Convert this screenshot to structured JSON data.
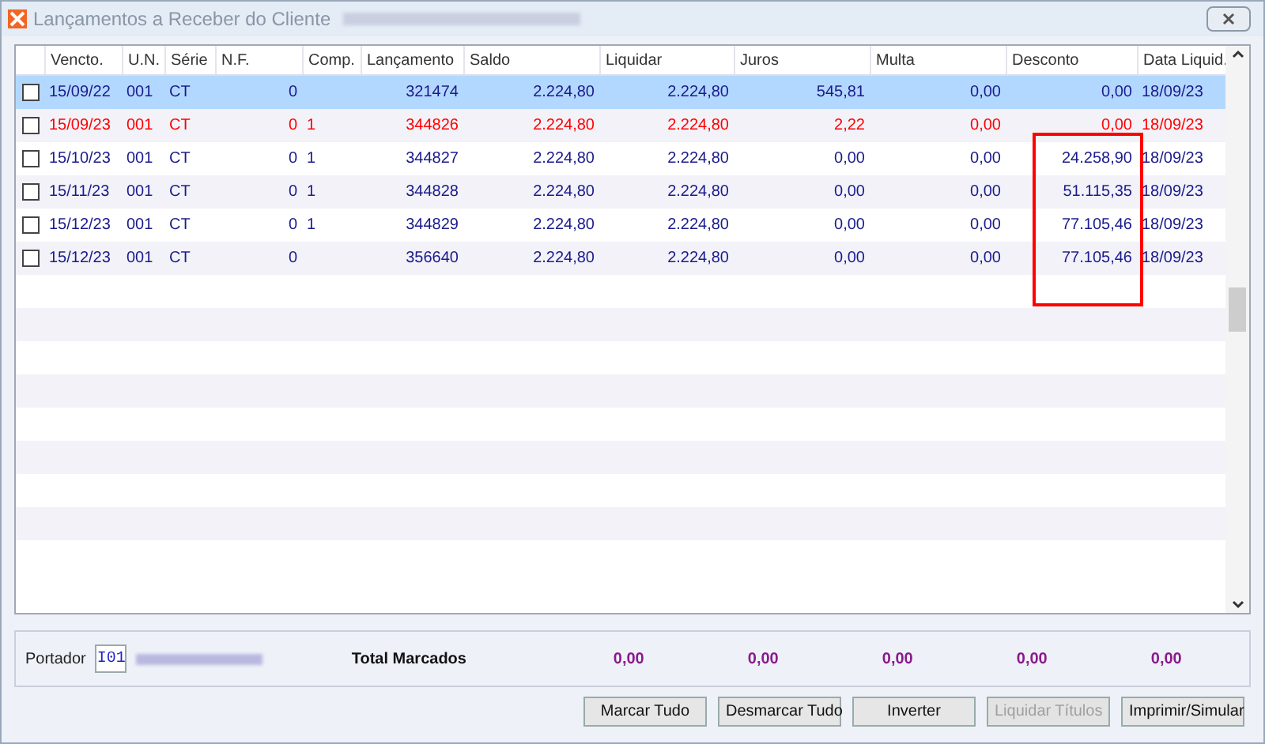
{
  "window": {
    "title": "Lançamentos a Receber do Cliente"
  },
  "table": {
    "columns": [
      "Vencto.",
      "U.N.",
      "Série",
      "N.F.",
      "Comp.",
      "Lançamento",
      "Saldo",
      "Liquidar",
      "Juros",
      "Multa",
      "Desconto",
      "Data Liquid."
    ],
    "rows": [
      {
        "selected": true,
        "checked": false,
        "color": "#1a1a8c",
        "cells": [
          "15/09/22",
          "001",
          "CT",
          "0",
          "",
          "321474",
          "2.224,80",
          "2.224,80",
          "545,81",
          "0,00",
          "0,00",
          "18/09/23"
        ]
      },
      {
        "selected": false,
        "checked": false,
        "color": "#ff0000",
        "cells": [
          "15/09/23",
          "001",
          "CT",
          "0",
          "1",
          "344826",
          "2.224,80",
          "2.224,80",
          "2,22",
          "0,00",
          "0,00",
          "18/09/23"
        ]
      },
      {
        "selected": false,
        "checked": false,
        "color": "#1a1a8c",
        "cells": [
          "15/10/23",
          "001",
          "CT",
          "0",
          "1",
          "344827",
          "2.224,80",
          "2.224,80",
          "0,00",
          "0,00",
          "24.258,90",
          "18/09/23"
        ]
      },
      {
        "selected": false,
        "checked": false,
        "color": "#1a1a8c",
        "cells": [
          "15/11/23",
          "001",
          "CT",
          "0",
          "1",
          "344828",
          "2.224,80",
          "2.224,80",
          "0,00",
          "0,00",
          "51.115,35",
          "18/09/23"
        ]
      },
      {
        "selected": false,
        "checked": false,
        "color": "#1a1a8c",
        "cells": [
          "15/12/23",
          "001",
          "CT",
          "0",
          "1",
          "344829",
          "2.224,80",
          "2.224,80",
          "0,00",
          "0,00",
          "77.105,46",
          "18/09/23"
        ]
      },
      {
        "selected": false,
        "checked": false,
        "color": "#1a1a8c",
        "cells": [
          "15/12/23",
          "001",
          "CT",
          "0",
          "",
          "356640",
          "2.224,80",
          "2.224,80",
          "0,00",
          "0,00",
          "77.105,46",
          "18/09/23"
        ]
      }
    ]
  },
  "footer": {
    "portador_label": "Portador",
    "portador_code": "I01",
    "total_label": "Total Marcados",
    "totals": [
      "0,00",
      "0,00",
      "0,00",
      "0,00",
      "0,00"
    ]
  },
  "buttons": [
    {
      "label": "Marcar Tudo",
      "disabled": false
    },
    {
      "label": "Desmarcar Tudo",
      "disabled": false
    },
    {
      "label": "Inverter",
      "disabled": false
    },
    {
      "label": "Liquidar Títulos",
      "disabled": true
    },
    {
      "label": "Imprimir/Simular",
      "disabled": false
    }
  ]
}
